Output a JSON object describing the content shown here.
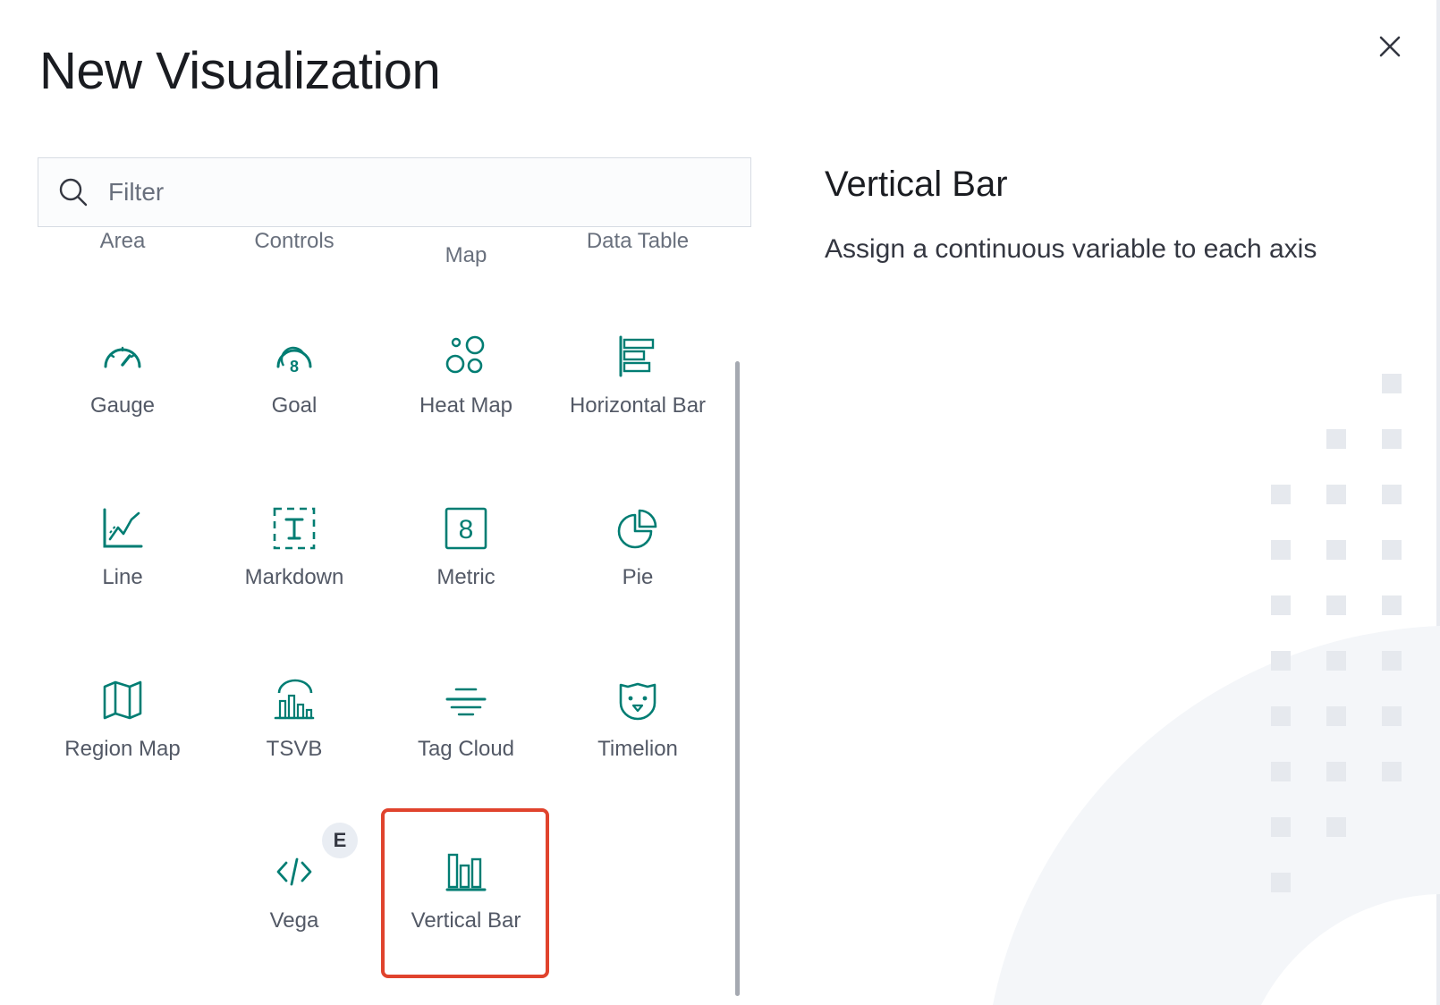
{
  "modal": {
    "title": "New Visualization",
    "close_icon": "close-icon"
  },
  "filter": {
    "placeholder": "Filter",
    "value": "",
    "icon": "search-icon"
  },
  "partial_row": [
    "Area",
    "Controls",
    "Map",
    "Data Table"
  ],
  "items": [
    {
      "label": "Gauge",
      "icon": "gauge-icon"
    },
    {
      "label": "Goal",
      "icon": "goal-icon"
    },
    {
      "label": "Heat Map",
      "icon": "heat-map-icon"
    },
    {
      "label": "Horizontal Bar",
      "icon": "horizontal-bar-icon"
    },
    {
      "label": "Line",
      "icon": "line-chart-icon"
    },
    {
      "label": "Markdown",
      "icon": "markdown-icon"
    },
    {
      "label": "Metric",
      "icon": "metric-icon"
    },
    {
      "label": "Pie",
      "icon": "pie-icon"
    },
    {
      "label": "Region Map",
      "icon": "region-map-icon"
    },
    {
      "label": "TSVB",
      "icon": "tsvb-icon"
    },
    {
      "label": "Tag Cloud",
      "icon": "tag-cloud-icon"
    },
    {
      "label": "Timelion",
      "icon": "timelion-icon"
    },
    {
      "label": "Vega",
      "icon": "vega-icon",
      "badge": "E"
    },
    {
      "label": "Vertical Bar",
      "icon": "vertical-bar-icon",
      "selected": true
    }
  ],
  "description": {
    "title": "Vertical Bar",
    "text": "Assign a continuous variable to each axis"
  },
  "colors": {
    "accent": "#017d73",
    "selection": "#e0432d"
  }
}
